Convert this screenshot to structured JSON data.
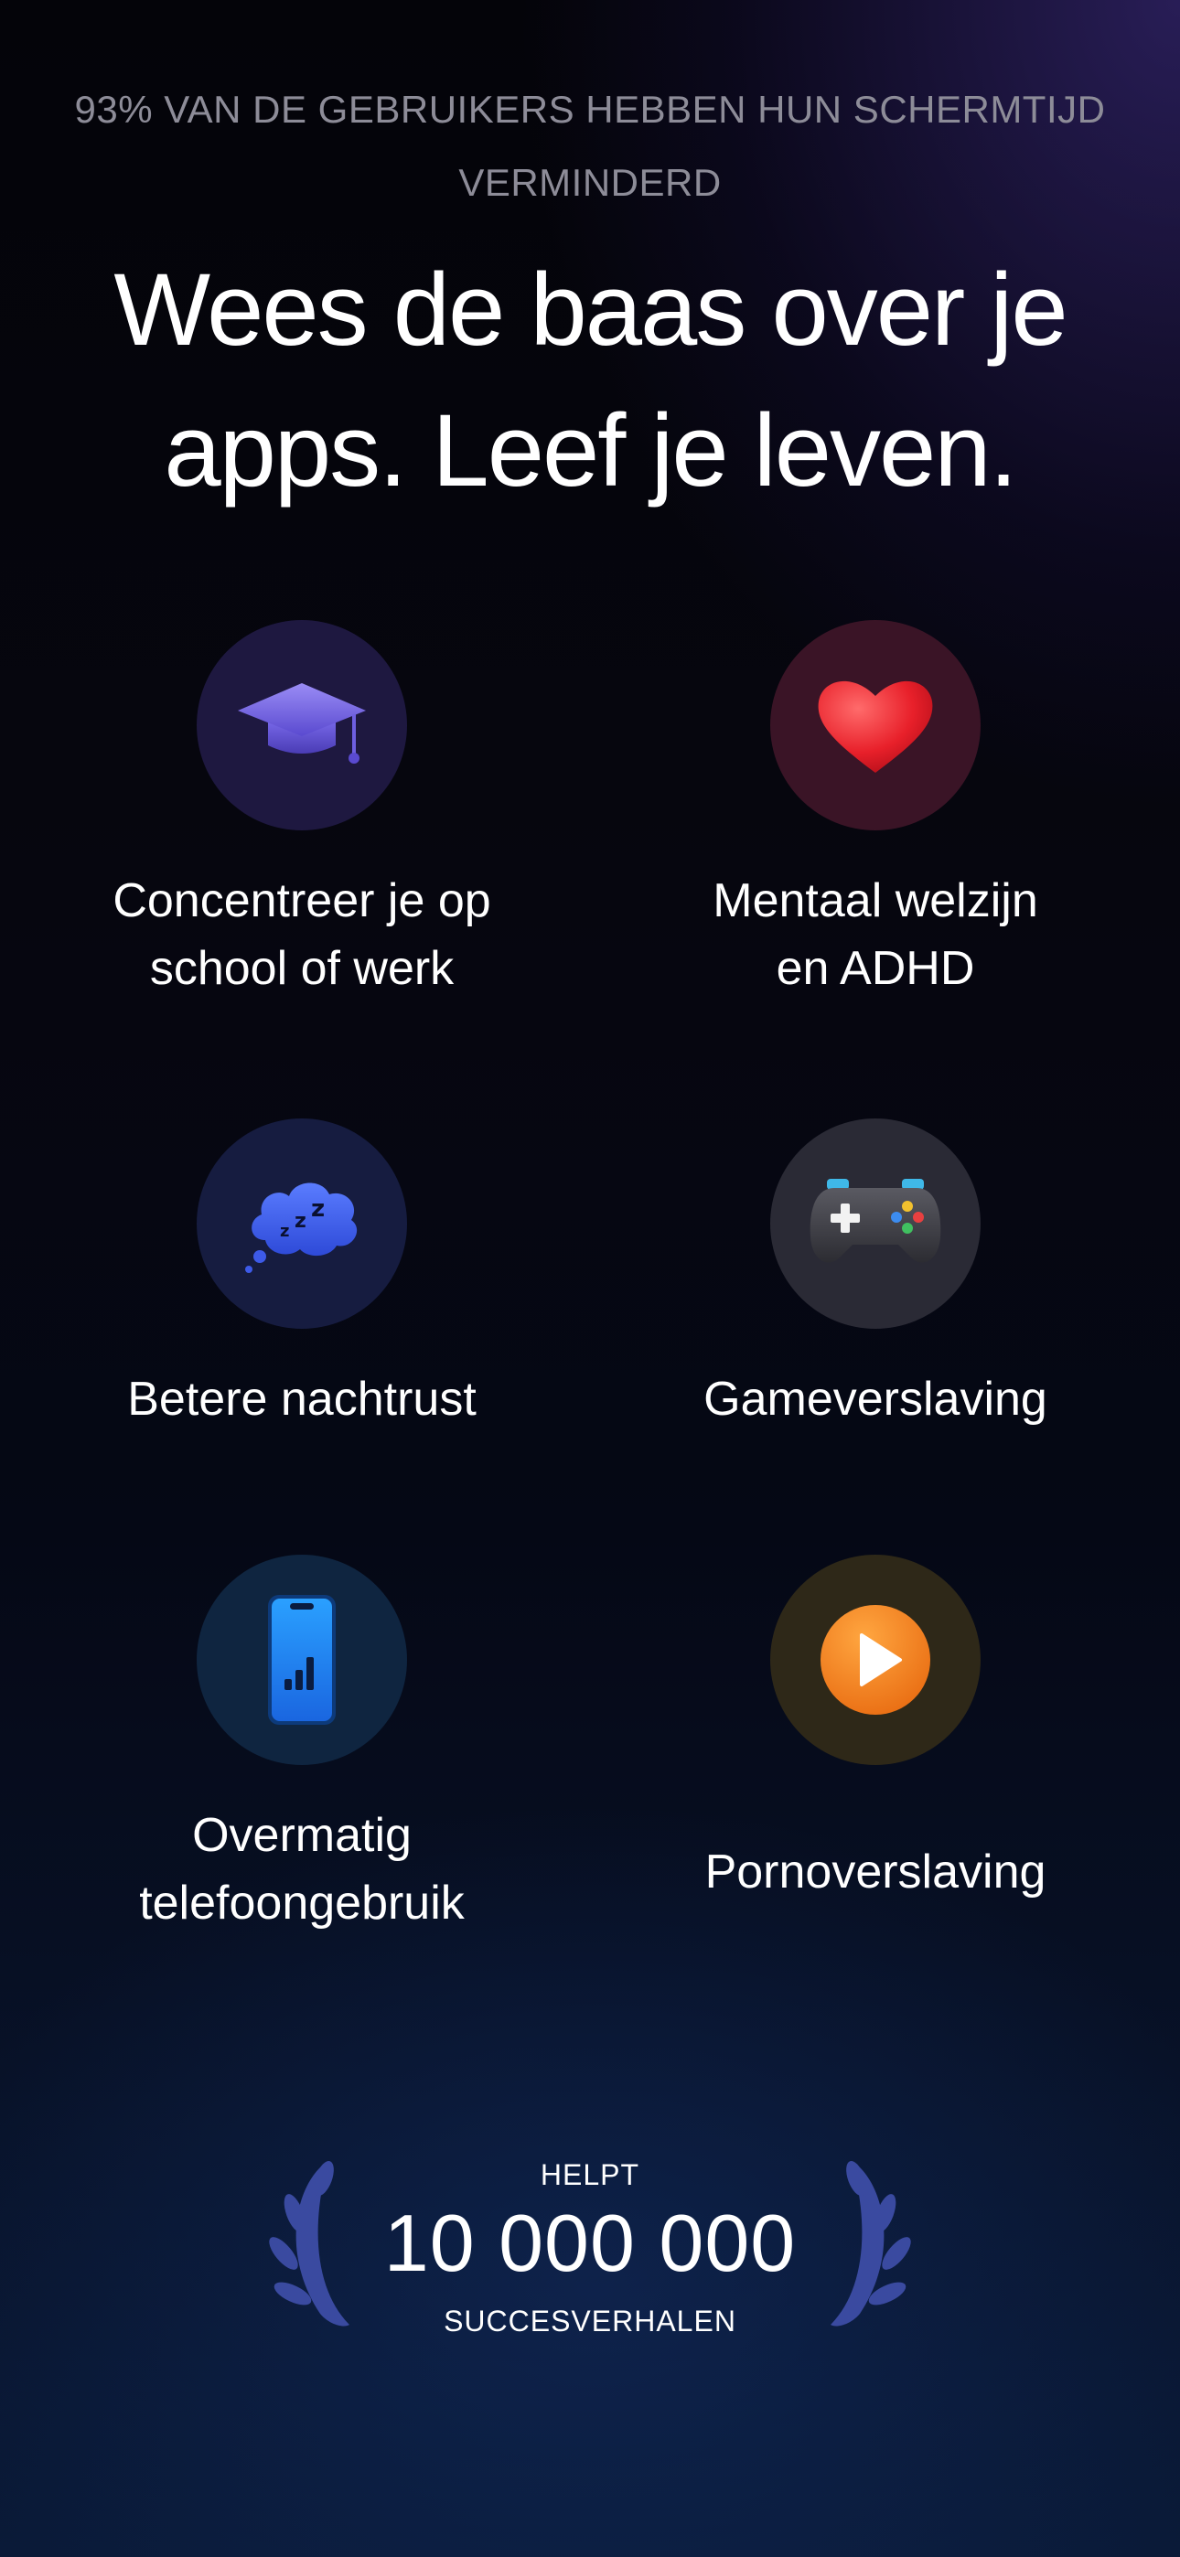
{
  "header": {
    "stat_line": "93% VAN DE GEBRUIKERS HEBBEN HUN SCHERMTIJD VERMINDERD",
    "headline_line1": "Wees de baas over je",
    "headline_line2": "apps. Leef je leven."
  },
  "benefits": [
    {
      "icon": "graduation-cap-icon",
      "label_line1": "Concentreer je op",
      "label_line2": "school of werk",
      "color": "#1e1840"
    },
    {
      "icon": "heart-icon",
      "label_line1": "Mentaal welzijn",
      "label_line2": "en ADHD",
      "color": "#3a1426"
    },
    {
      "icon": "sleep-cloud-icon",
      "label_line1": "Betere nachtrust",
      "color": "#161c40"
    },
    {
      "icon": "gamepad-icon",
      "label_line1": "Gameverslaving",
      "color": "#2a2a35"
    },
    {
      "icon": "phone-icon",
      "label_line1": "Overmatig",
      "label_line2": "telefoongebruik",
      "color": "#0f2540"
    },
    {
      "icon": "play-icon",
      "label_line1": "Pornoverslaving",
      "color": "#2e2818"
    }
  ],
  "badge": {
    "top_text": "HELPT",
    "number": "10 000 000",
    "bottom_text": "SUCCESVERHALEN",
    "laurel_color": "#3a4aa0"
  }
}
